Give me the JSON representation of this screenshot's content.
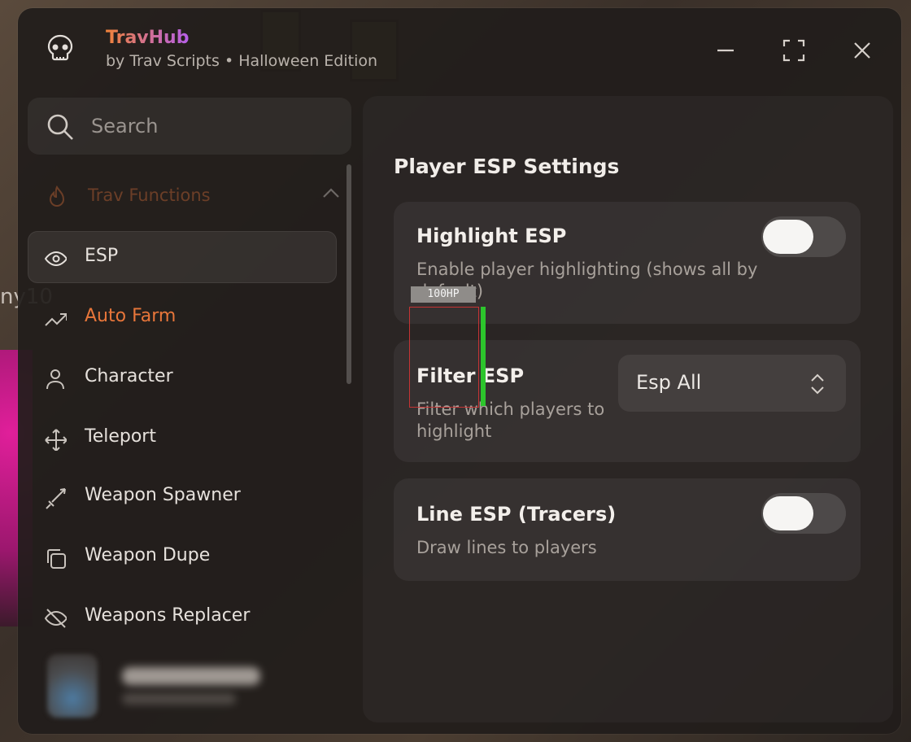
{
  "app": {
    "title": "TravHub",
    "subtitle": "by Trav Scripts • Halloween Edition"
  },
  "search": {
    "placeholder": "Search"
  },
  "sidebar": {
    "section": {
      "label": "Trav Functions",
      "icon": "flame-icon"
    },
    "items": [
      {
        "label": "ESP",
        "icon": "eye-icon",
        "active": true
      },
      {
        "label": "Auto Farm",
        "icon": "trend-icon"
      },
      {
        "label": "Character",
        "icon": "user-icon"
      },
      {
        "label": "Teleport",
        "icon": "move-icon"
      },
      {
        "label": "Weapon Spawner",
        "icon": "sword-icon"
      },
      {
        "label": "Weapon Dupe",
        "icon": "copy-icon"
      },
      {
        "label": "Weapons Replacer",
        "icon": "eye-off-icon"
      }
    ]
  },
  "main": {
    "title": "Player ESP Settings",
    "cards": [
      {
        "name": "Highlight ESP",
        "description": "Enable player highlighting (shows all by default)",
        "toggle": false
      },
      {
        "name": "Filter ESP",
        "description": "Filter which players to highlight",
        "dropdown": "Esp All"
      },
      {
        "name": "Line ESP (Tracers)",
        "description": "Draw lines to players",
        "toggle": false
      }
    ]
  },
  "overlay": {
    "hp_label": "100HP"
  },
  "background": {
    "name_fragment": "ny10"
  },
  "colors": {
    "accent_orange": "#e8763a",
    "accent_purple": "#b65fe8",
    "hp_green": "#2cc52c",
    "esp_red": "#c53434"
  }
}
